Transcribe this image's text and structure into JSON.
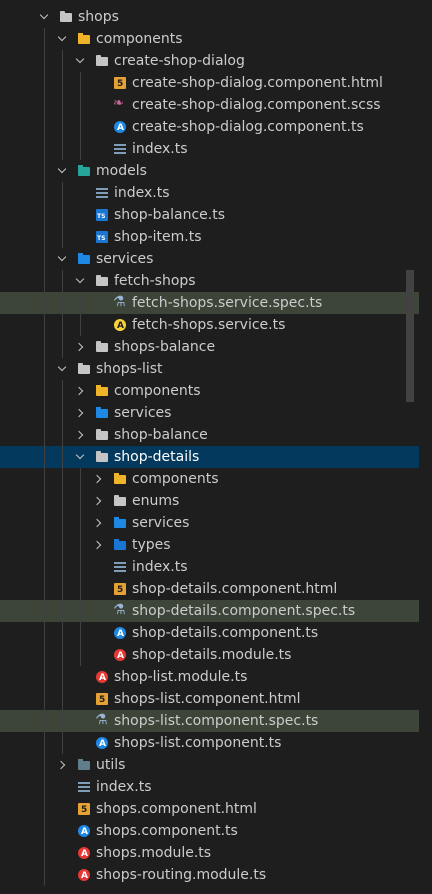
{
  "tree": [
    {
      "label": "shops",
      "depth": 0,
      "kind": "folder",
      "chevron": "down",
      "icon": "folder-icon"
    },
    {
      "label": "components",
      "depth": 1,
      "kind": "folder",
      "chevron": "down",
      "icon": "folder-components-icon"
    },
    {
      "label": "create-shop-dialog",
      "depth": 2,
      "kind": "folder",
      "chevron": "down",
      "icon": "folder-icon"
    },
    {
      "label": "create-shop-dialog.component.html",
      "depth": 3,
      "kind": "file",
      "icon": "html-file-icon"
    },
    {
      "label": "create-shop-dialog.component.scss",
      "depth": 3,
      "kind": "file",
      "icon": "scss-file-icon"
    },
    {
      "label": "create-shop-dialog.component.ts",
      "depth": 3,
      "kind": "file",
      "icon": "angular-component-icon"
    },
    {
      "label": "index.ts",
      "depth": 3,
      "kind": "file",
      "icon": "index-file-icon"
    },
    {
      "label": "models",
      "depth": 1,
      "kind": "folder",
      "chevron": "down",
      "icon": "folder-models-icon"
    },
    {
      "label": "index.ts",
      "depth": 2,
      "kind": "file",
      "icon": "index-file-icon"
    },
    {
      "label": "shop-balance.ts",
      "depth": 2,
      "kind": "file",
      "icon": "typescript-file-icon"
    },
    {
      "label": "shop-item.ts",
      "depth": 2,
      "kind": "file",
      "icon": "typescript-file-icon"
    },
    {
      "label": "services",
      "depth": 1,
      "kind": "folder",
      "chevron": "down",
      "icon": "folder-services-icon"
    },
    {
      "label": "fetch-shops",
      "depth": 2,
      "kind": "folder",
      "chevron": "down",
      "icon": "folder-icon"
    },
    {
      "label": "fetch-shops.service.spec.ts",
      "depth": 3,
      "kind": "file",
      "icon": "spec-file-icon",
      "state": "highlight"
    },
    {
      "label": "fetch-shops.service.ts",
      "depth": 3,
      "kind": "file",
      "icon": "angular-service-icon"
    },
    {
      "label": "shops-balance",
      "depth": 2,
      "kind": "folder",
      "chevron": "right",
      "icon": "folder-icon"
    },
    {
      "label": "shops-list",
      "depth": 1,
      "kind": "folder",
      "chevron": "down",
      "icon": "folder-icon"
    },
    {
      "label": "components",
      "depth": 2,
      "kind": "folder",
      "chevron": "right",
      "icon": "folder-components-icon"
    },
    {
      "label": "services",
      "depth": 2,
      "kind": "folder",
      "chevron": "right",
      "icon": "folder-services-icon"
    },
    {
      "label": "shop-balance",
      "depth": 2,
      "kind": "folder",
      "chevron": "right",
      "icon": "folder-icon"
    },
    {
      "label": "shop-details",
      "depth": 2,
      "kind": "folder",
      "chevron": "down",
      "icon": "folder-icon",
      "state": "selected"
    },
    {
      "label": "components",
      "depth": 3,
      "kind": "folder",
      "chevron": "right",
      "icon": "folder-components-icon"
    },
    {
      "label": "enums",
      "depth": 3,
      "kind": "folder",
      "chevron": "right",
      "icon": "folder-icon"
    },
    {
      "label": "services",
      "depth": 3,
      "kind": "folder",
      "chevron": "right",
      "icon": "folder-services-icon"
    },
    {
      "label": "types",
      "depth": 3,
      "kind": "folder",
      "chevron": "right",
      "icon": "folder-types-icon"
    },
    {
      "label": "index.ts",
      "depth": 3,
      "kind": "file",
      "icon": "index-file-icon"
    },
    {
      "label": "shop-details.component.html",
      "depth": 3,
      "kind": "file",
      "icon": "html-file-icon"
    },
    {
      "label": "shop-details.component.spec.ts",
      "depth": 3,
      "kind": "file",
      "icon": "spec-file-icon",
      "state": "highlight"
    },
    {
      "label": "shop-details.component.ts",
      "depth": 3,
      "kind": "file",
      "icon": "angular-component-icon"
    },
    {
      "label": "shop-details.module.ts",
      "depth": 3,
      "kind": "file",
      "icon": "angular-module-icon"
    },
    {
      "label": "shop-list.module.ts",
      "depth": 2,
      "kind": "file",
      "icon": "angular-module-icon"
    },
    {
      "label": "shops-list.component.html",
      "depth": 2,
      "kind": "file",
      "icon": "html-file-icon"
    },
    {
      "label": "shops-list.component.spec.ts",
      "depth": 2,
      "kind": "file",
      "icon": "spec-file-icon",
      "state": "highlight"
    },
    {
      "label": "shops-list.component.ts",
      "depth": 2,
      "kind": "file",
      "icon": "angular-component-icon"
    },
    {
      "label": "utils",
      "depth": 1,
      "kind": "folder",
      "chevron": "right",
      "icon": "folder-utils-icon"
    },
    {
      "label": "index.ts",
      "depth": 1,
      "kind": "file",
      "icon": "index-file-icon"
    },
    {
      "label": "shops.component.html",
      "depth": 1,
      "kind": "file",
      "icon": "html-file-icon"
    },
    {
      "label": "shops.component.ts",
      "depth": 1,
      "kind": "file",
      "icon": "angular-component-icon"
    },
    {
      "label": "shops.module.ts",
      "depth": 1,
      "kind": "file",
      "icon": "angular-module-icon"
    },
    {
      "label": "shops-routing.module.ts",
      "depth": 1,
      "kind": "file",
      "icon": "angular-module-icon"
    }
  ],
  "colors": {
    "background": "#1e1e1e",
    "selected": "#04395e",
    "highlight": "#3c4538",
    "text": "#cccccc"
  }
}
